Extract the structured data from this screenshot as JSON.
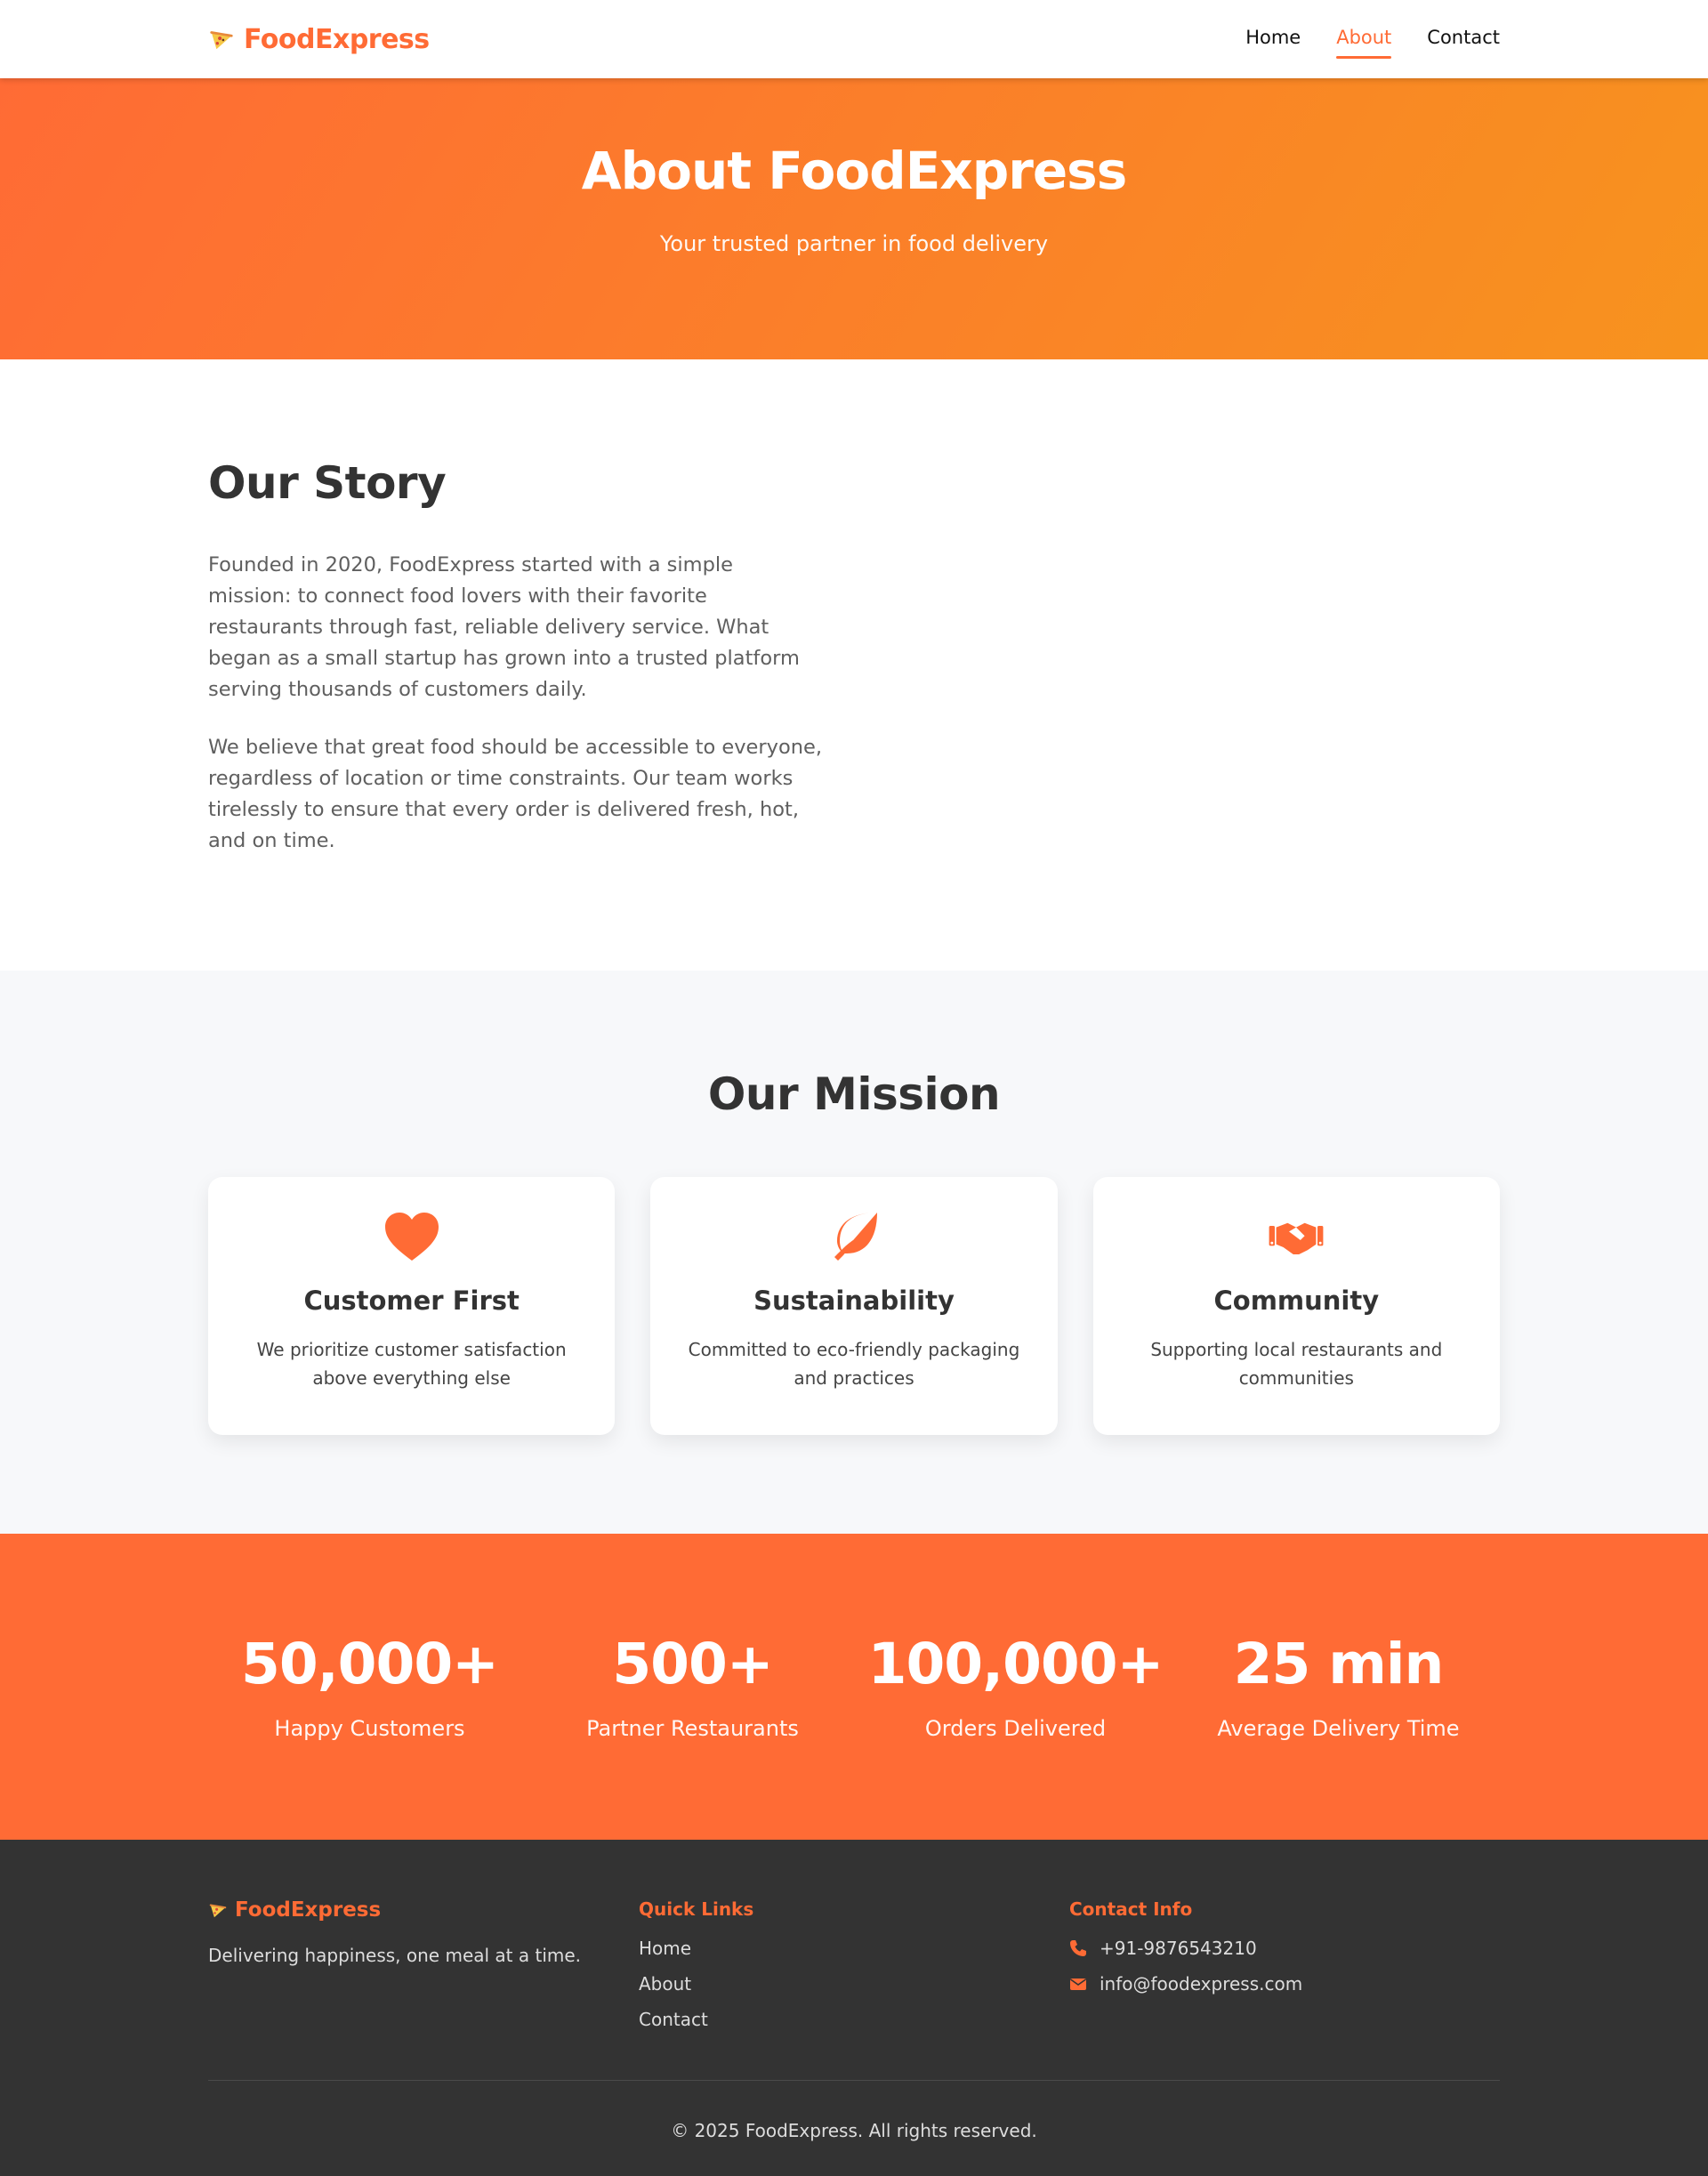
{
  "header": {
    "brand": "FoodExpress",
    "brand_icon": "pizza-icon",
    "nav": [
      {
        "label": "Home",
        "active": false
      },
      {
        "label": "About",
        "active": true
      },
      {
        "label": "Contact",
        "active": false
      }
    ]
  },
  "hero": {
    "title": "About FoodExpress",
    "subtitle": "Your trusted partner in food delivery"
  },
  "story": {
    "title": "Our Story",
    "paragraphs": [
      "Founded in 2020, FoodExpress started with a simple mission: to connect food lovers with their favorite restaurants through fast, reliable delivery service. What began as a small startup has grown into a trusted platform serving thousands of customers daily.",
      "We believe that great food should be accessible to everyone, regardless of location or time constraints. Our team works tirelessly to ensure that every order is delivered fresh, hot, and on time."
    ]
  },
  "mission": {
    "title": "Our Mission",
    "cards": [
      {
        "icon": "heart-icon",
        "title": "Customer First",
        "text": "We prioritize customer satisfaction above everything else"
      },
      {
        "icon": "leaf-icon",
        "title": "Sustainability",
        "text": "Committed to eco-friendly packaging and practices"
      },
      {
        "icon": "handshake-icon",
        "title": "Community",
        "text": "Supporting local restaurants and communities"
      }
    ]
  },
  "stats": [
    {
      "value": "50,000+",
      "label": "Happy Customers"
    },
    {
      "value": "500+",
      "label": "Partner Restaurants"
    },
    {
      "value": "100,000+",
      "label": "Orders Delivered"
    },
    {
      "value": "25 min",
      "label": "Average Delivery Time"
    }
  ],
  "footer": {
    "brand": "FoodExpress",
    "tagline": "Delivering happiness, one meal at a time.",
    "quick_links_title": "Quick Links",
    "quick_links": [
      "Home",
      "About",
      "Contact"
    ],
    "contact_title": "Contact Info",
    "phone": "+91-9876543210",
    "email": "info@foodexpress.com",
    "copyright": "© 2025 FoodExpress. All rights reserved."
  },
  "colors": {
    "accent": "#ff6b35",
    "gradient_end": "#f7931e",
    "footer_bg": "#333333",
    "mission_bg": "#f7f8fa"
  }
}
